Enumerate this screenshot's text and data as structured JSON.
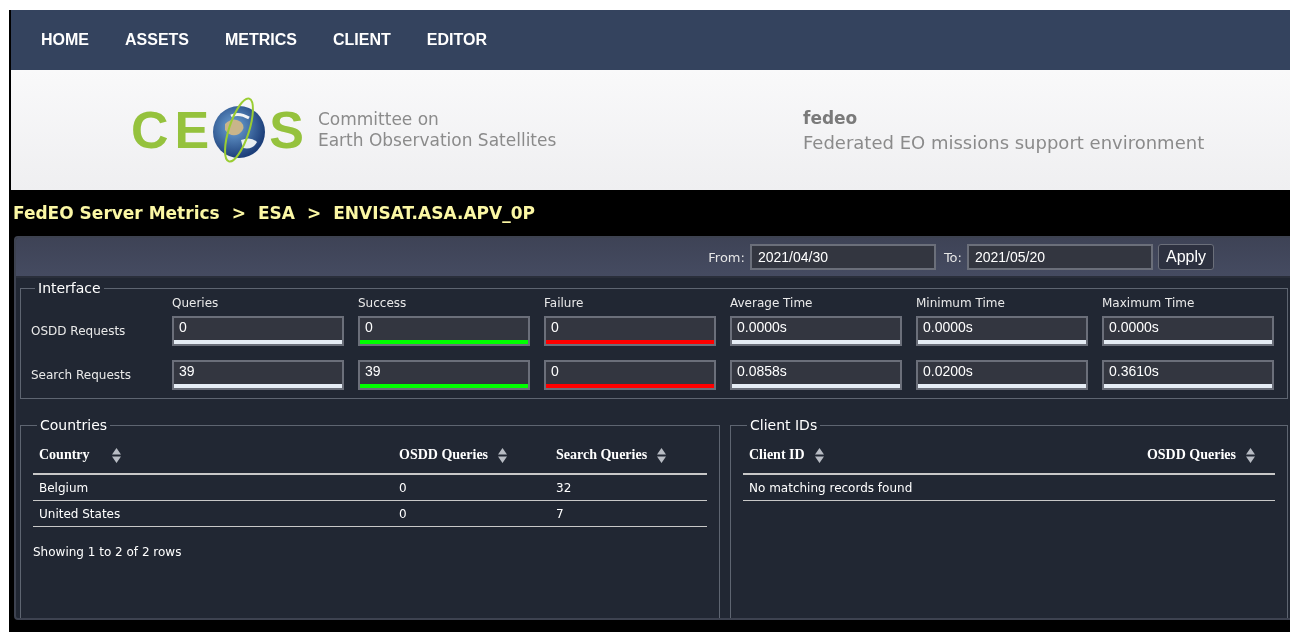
{
  "nav": {
    "items": [
      {
        "label": "HOME"
      },
      {
        "label": "ASSETS"
      },
      {
        "label": "METRICS"
      },
      {
        "label": "CLIENT"
      },
      {
        "label": "EDITOR"
      }
    ]
  },
  "banner": {
    "logo_letters_left": "CE",
    "logo_letters_right": "S",
    "org_lines": [
      "Committee on",
      "Earth Observation Satellites"
    ],
    "site_name": "fedeo",
    "site_tagline": "Federated EO missions support environment"
  },
  "breadcrumb": {
    "items": [
      "FedEO Server Metrics",
      "ESA",
      "ENVISAT.ASA.APV_0P"
    ],
    "separator": ">"
  },
  "date_filter": {
    "from_label": "From:",
    "from_value": "2021/04/30",
    "to_label": "To:",
    "to_value": "2021/05/20",
    "apply_button": "Apply"
  },
  "interface": {
    "title": "Interface",
    "columns": [
      {
        "label": "Queries",
        "color": "#e6edf5"
      },
      {
        "label": "Success",
        "color": "#00ff00"
      },
      {
        "label": "Failure",
        "color": "#ff0000"
      },
      {
        "label": "Average Time",
        "color": "#e6edf5"
      },
      {
        "label": "Minimum Time",
        "color": "#e6edf5"
      },
      {
        "label": "Maximum Time",
        "color": "#e6edf5"
      }
    ],
    "rows": [
      {
        "label": "OSDD Requests",
        "values": [
          "0",
          "0",
          "0",
          "0.0000s",
          "0.0000s",
          "0.0000s"
        ]
      },
      {
        "label": "Search Requests",
        "values": [
          "39",
          "39",
          "0",
          "0.0858s",
          "0.0200s",
          "0.3610s"
        ]
      }
    ]
  },
  "countries": {
    "title": "Countries",
    "columns": [
      "Country",
      "OSDD Queries",
      "Search Queries"
    ],
    "rows": [
      [
        "Belgium",
        "0",
        "32"
      ],
      [
        "United States",
        "0",
        "7"
      ]
    ],
    "footer": "Showing 1 to 2 of 2 rows"
  },
  "client_ids": {
    "title": "Client IDs",
    "columns": [
      "Client ID",
      "OSDD Queries"
    ],
    "empty_message": "No matching records found"
  }
}
